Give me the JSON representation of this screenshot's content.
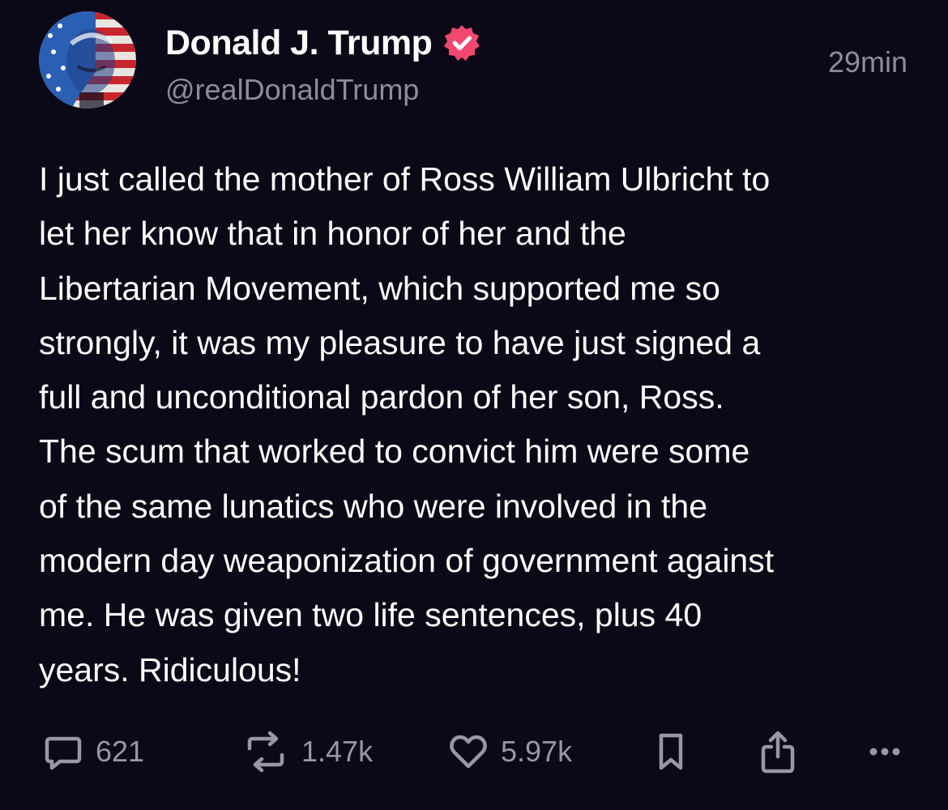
{
  "post": {
    "author": {
      "display_name": "Donald J. Trump",
      "handle": "@realDonaldTrump",
      "verified_icon": "verified-badge-icon",
      "badge_color": "#f2476f"
    },
    "timestamp": "29min",
    "text": "I just called the mother of Ross William Ulbricht to\nlet her know that in honor of her and the\nLibertarian Movement, which supported me so\nstrongly, it was my pleasure to have just signed a\nfull and unconditional pardon of her son, Ross.\nThe scum that worked to convict him were some\nof the same lunatics who were involved in the\nmodern day weaponization of government against\nme. He was given two life sentences, plus 40\nyears. Ridiculous!",
    "actions": {
      "replies": {
        "icon": "comment-icon",
        "count": "621"
      },
      "reposts": {
        "icon": "repost-icon",
        "count": "1.47k"
      },
      "likes": {
        "icon": "heart-icon",
        "count": "5.97k"
      },
      "bookmark": {
        "icon": "bookmark-icon"
      },
      "share": {
        "icon": "share-icon"
      },
      "more": {
        "icon": "more-icon"
      }
    }
  },
  "colors": {
    "background": "#0b0817",
    "text": "#ffffff",
    "muted": "#8d8c99"
  }
}
